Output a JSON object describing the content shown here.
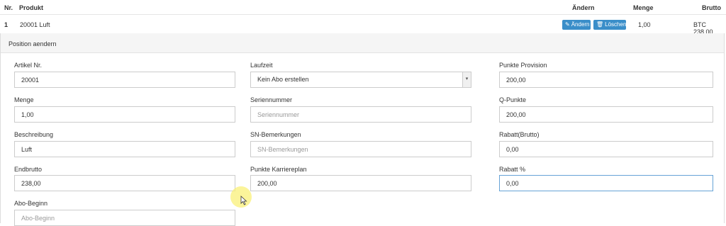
{
  "table": {
    "headers": {
      "nr": "Nr.",
      "produkt": "Produkt",
      "aendern": "Ändern",
      "menge": "Menge",
      "brutto": "Brutto"
    },
    "row": {
      "nr": "1",
      "produkt": "20001 Luft",
      "edit_label": "Ändern",
      "delete_label": "Löschen",
      "menge": "1,00",
      "brutto": "BTC 238,00"
    }
  },
  "panel": {
    "title": "Position aendern",
    "fields": {
      "artikel_nr": {
        "label": "Artikel Nr.",
        "value": "20001",
        "placeholder": ""
      },
      "menge": {
        "label": "Menge",
        "value": "1,00",
        "placeholder": ""
      },
      "beschreibung": {
        "label": "Beschreibung",
        "value": "Luft",
        "placeholder": ""
      },
      "endbrutto": {
        "label": "Endbrutto",
        "value": "238,00",
        "placeholder": ""
      },
      "abo_beginn": {
        "label": "Abo-Beginn",
        "value": "",
        "placeholder": "Abo-Beginn"
      },
      "laufzeit": {
        "label": "Laufzeit",
        "value": "Kein Abo erstellen"
      },
      "seriennummer": {
        "label": "Seriennummer",
        "value": "",
        "placeholder": "Seriennummer"
      },
      "sn_bemerkungen": {
        "label": "SN-Bemerkungen",
        "value": "",
        "placeholder": "SN-Bemerkungen"
      },
      "punkte_karriereplan": {
        "label": "Punkte Karriereplan",
        "value": "200,00",
        "placeholder": ""
      },
      "punkte_provision": {
        "label": "Punkte Provision",
        "value": "200,00",
        "placeholder": ""
      },
      "q_punkte": {
        "label": "Q-Punkte",
        "value": "200,00",
        "placeholder": ""
      },
      "rabatt_brutto": {
        "label": "Rabatt(Brutto)",
        "value": "0,00",
        "placeholder": ""
      },
      "rabatt_prozent": {
        "label": "Rabatt %",
        "value": "0,00",
        "placeholder": ""
      }
    }
  },
  "icons": {
    "edit": "pencil-icon",
    "delete": "trash-icon",
    "select": "chevron-down-icon"
  },
  "colors": {
    "button": "#3a8ec9",
    "focus_border": "#66a3d6"
  }
}
